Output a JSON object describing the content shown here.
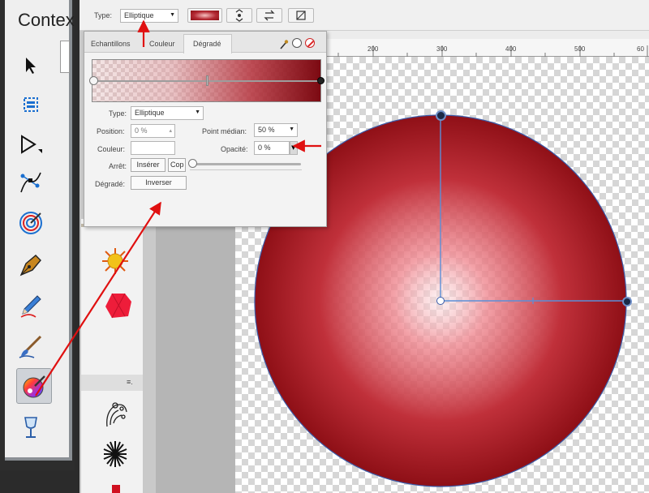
{
  "left_panel": {
    "title": "Contex",
    "tools": [
      {
        "name": "selection-arrow-icon"
      },
      {
        "name": "crop-frame-icon"
      },
      {
        "name": "node-select-icon"
      },
      {
        "name": "bezier-node-icon"
      },
      {
        "name": "contour-target-icon"
      },
      {
        "name": "pen-nib-icon"
      },
      {
        "name": "pencil-icon"
      },
      {
        "name": "brush-icon"
      },
      {
        "name": "fill-palette-icon"
      },
      {
        "name": "transparency-glass-icon"
      }
    ],
    "active_tool": "fill-palette-icon"
  },
  "toolbar": {
    "type_label": "Type:",
    "type_value": "Elliptique",
    "gradient_swatch": {
      "start": "#f7c0c0",
      "end": "#8a0e14"
    }
  },
  "dialog": {
    "tabs": [
      "Echantillons",
      "Couleur",
      "Dégradé"
    ],
    "active_tab": "Dégradé",
    "type_label": "Type:",
    "type_value": "Elliptique",
    "position_label": "Position:",
    "position_value": "0 %",
    "midpoint_label": "Point médian:",
    "midpoint_value": "50 %",
    "color_label": "Couleur:",
    "opacity_label": "Opacité:",
    "opacity_value": "0 %",
    "stop_label": "Arrêt:",
    "insert_button": "Insérer",
    "copy_button": "Cop",
    "gradient_label": "Dégradé:",
    "invert_button": "Inverser"
  },
  "ruler": {
    "ticks": [
      "200",
      "300",
      "400",
      "500",
      "60"
    ]
  },
  "canvas": {
    "shape": "circle",
    "gradient_center": "#fde6e8",
    "gradient_edge": "#8e0f16"
  },
  "library": {
    "menu_glyph": "≡."
  },
  "annotations": {
    "arrow_color": "#e01010"
  }
}
